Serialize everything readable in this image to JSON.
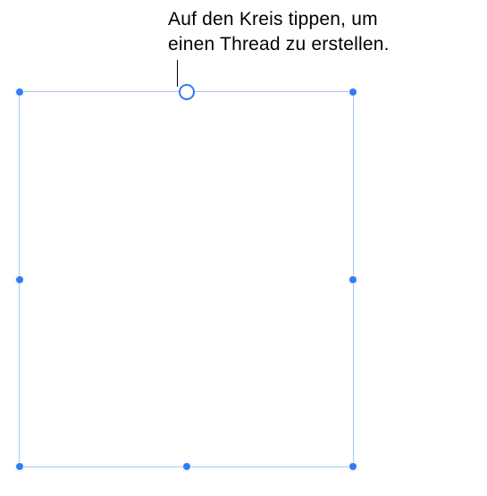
{
  "callout": {
    "line1": "Auf den Kreis tippen, um",
    "line2": "einen Thread zu erstellen."
  },
  "colors": {
    "handle_fill": "#2f7cf6",
    "selection_border": "#a8c7f0",
    "thread_circle_border": "#2f7cf6",
    "thread_circle_fill": "#ffffff"
  }
}
